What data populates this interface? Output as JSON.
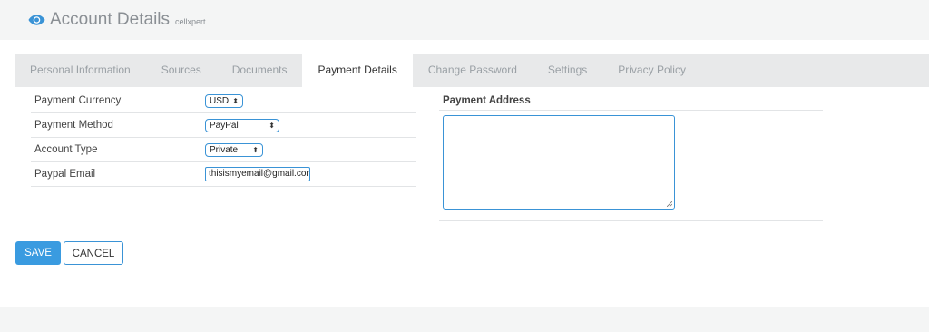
{
  "header": {
    "title": "Account Details",
    "subtitle": "cellxpert",
    "icon": "eye-icon",
    "accent": "#3a93d6"
  },
  "tabs": [
    {
      "label": "Personal Information",
      "active": false
    },
    {
      "label": "Sources",
      "active": false
    },
    {
      "label": "Documents",
      "active": false
    },
    {
      "label": "Payment Details",
      "active": true
    },
    {
      "label": "Change Password",
      "active": false
    },
    {
      "label": "Settings",
      "active": false
    },
    {
      "label": "Privacy Policy",
      "active": false
    }
  ],
  "form": {
    "currency_label": "Payment Currency",
    "currency_value": "USD",
    "method_label": "Payment Method",
    "method_value": "PayPal",
    "account_type_label": "Account Type",
    "account_type_value": "Private",
    "email_label": "Paypal Email",
    "email_value": "thisismyemail@gmail.com"
  },
  "address": {
    "label": "Payment Address",
    "value": ""
  },
  "buttons": {
    "save": "SAVE",
    "cancel": "CANCEL"
  }
}
